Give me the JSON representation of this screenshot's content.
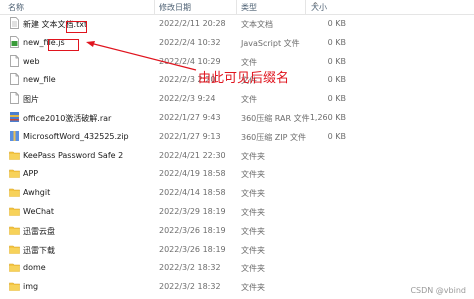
{
  "header": {
    "name": "名称",
    "date": "修改日期",
    "type": "类型",
    "size": "大小"
  },
  "files": [
    {
      "name": "新建 文本文档.txt",
      "date": "2022/2/11 20:28",
      "type": "文本文档",
      "size": "0 KB",
      "icon": "text-file-icon"
    },
    {
      "name": "new_file.js",
      "date": "2022/2/4 10:32",
      "type": "JavaScript 文件",
      "size": "0 KB",
      "icon": "js-file-icon"
    },
    {
      "name": "web",
      "date": "2022/2/4 10:29",
      "type": "文件",
      "size": "0 KB",
      "icon": "generic-file-icon"
    },
    {
      "name": "new_file",
      "date": "2022/2/3 2:20",
      "type": "文件",
      "size": "0 KB",
      "icon": "generic-file-icon"
    },
    {
      "name": "图片",
      "date": "2022/2/3 9:24",
      "type": "文件",
      "size": "0 KB",
      "icon": "generic-file-icon"
    },
    {
      "name": "office2010激活破解.rar",
      "date": "2022/1/27 9:43",
      "type": "360压缩 RAR 文件",
      "size": "1,260 KB",
      "icon": "rar-archive-icon"
    },
    {
      "name": "MicrosoftWord_432525.zip",
      "date": "2022/1/27 9:13",
      "type": "360压缩 ZIP 文件",
      "size": "0 KB",
      "icon": "zip-archive-icon"
    },
    {
      "name": "KeePass Password Safe 2",
      "date": "2022/4/21 22:30",
      "type": "文件夹",
      "size": "",
      "icon": "folder-icon"
    },
    {
      "name": "APP",
      "date": "2022/4/19 18:58",
      "type": "文件夹",
      "size": "",
      "icon": "folder-icon"
    },
    {
      "name": "Awhgit",
      "date": "2022/4/14 18:58",
      "type": "文件夹",
      "size": "",
      "icon": "folder-icon"
    },
    {
      "name": "WeChat",
      "date": "2022/3/29 18:19",
      "type": "文件夹",
      "size": "",
      "icon": "folder-icon"
    },
    {
      "name": "迅雷云盘",
      "date": "2022/3/26 18:19",
      "type": "文件夹",
      "size": "",
      "icon": "folder-icon"
    },
    {
      "name": "迅雷下载",
      "date": "2022/3/26 18:19",
      "type": "文件夹",
      "size": "",
      "icon": "folder-icon"
    },
    {
      "name": "dome",
      "date": "2022/3/2 18:32",
      "type": "文件夹",
      "size": "",
      "icon": "folder-icon"
    },
    {
      "name": "img",
      "date": "2022/3/2 18:32",
      "type": "文件夹",
      "size": "",
      "icon": "folder-icon"
    }
  ],
  "annotation": {
    "text": "由此可见后缀名",
    "color": "#e0141e"
  },
  "watermark": "CSDN @vbind",
  "colors": {
    "folder": "#f4c542",
    "annotation": "#e0141e",
    "header_text": "#4d6073"
  }
}
